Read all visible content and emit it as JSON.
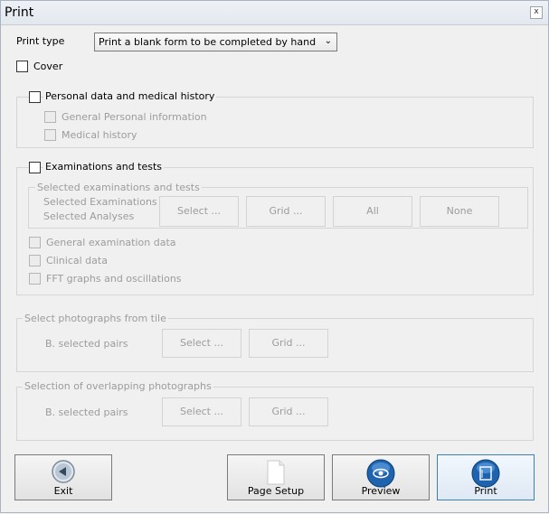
{
  "window": {
    "title": "Print",
    "close_glyph": "x"
  },
  "print_type": {
    "label": "Print type",
    "value": "Print a blank form to be completed by hand"
  },
  "cover": {
    "label": "Cover",
    "checked": false
  },
  "personal": {
    "label": "Personal data and medical history",
    "items": [
      "General Personal information",
      "Medical history"
    ]
  },
  "exams": {
    "label": "Examinations and tests",
    "selected_group": {
      "title": "Selected examinations and tests",
      "line1": "Selected Examinations",
      "line2": "Selected Analyses",
      "buttons": [
        "Select ...",
        "Grid ...",
        "All",
        "None"
      ]
    },
    "items": [
      "General examination data",
      "Clinical data",
      "FFT graphs and oscillations"
    ]
  },
  "photos_tile": {
    "title": "Select photographs from tile",
    "label": "B. selected pairs",
    "buttons": [
      "Select ...",
      "Grid ..."
    ]
  },
  "photos_overlap": {
    "title": "Selection of overlapping photographs",
    "label": "B. selected pairs",
    "buttons": [
      "Select ...",
      "Grid ..."
    ]
  },
  "footer": {
    "exit": {
      "label": "Exit",
      "icon": "back-arrow-icon"
    },
    "page_setup": {
      "label": "Page Setup",
      "icon": "page-icon"
    },
    "preview": {
      "label": "Preview",
      "icon": "eye-icon"
    },
    "print": {
      "label": "Print",
      "icon": "printer-icon"
    }
  },
  "colors": {
    "accent": "#1a5fa8",
    "disabled_text": "#9c9c9c"
  }
}
